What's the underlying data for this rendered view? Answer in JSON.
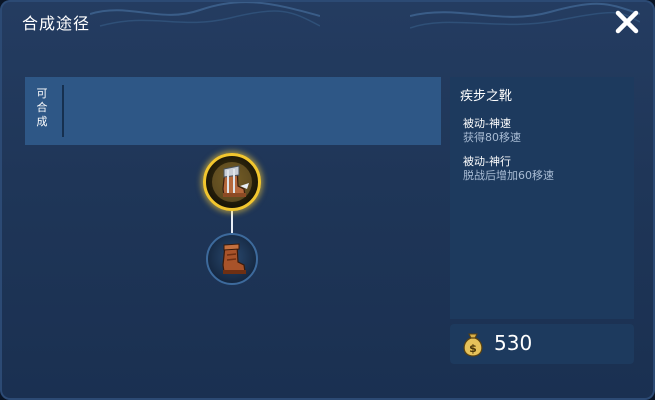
{
  "window": {
    "title": "合成途径"
  },
  "recipe": {
    "label_chars": [
      "可",
      "合",
      "成"
    ]
  },
  "tree": {
    "top_item": {
      "icon": "speed-boots-icon"
    },
    "bottom_item": {
      "icon": "leather-boots-icon"
    }
  },
  "detail": {
    "item_name": "疾步之靴",
    "passives": [
      {
        "name": "被动-神速",
        "desc": "获得80移速"
      },
      {
        "name": "被动-神行",
        "desc": "脱战后增加60移速"
      }
    ]
  },
  "price": {
    "icon": "gold-bag-icon",
    "value": "530"
  },
  "colors": {
    "background": "#1f3658",
    "panel": "#1d3a5e",
    "strip": "#2e5786",
    "highlight_ring": "#f2c62e",
    "secondary_text": "#a9bcd4"
  }
}
